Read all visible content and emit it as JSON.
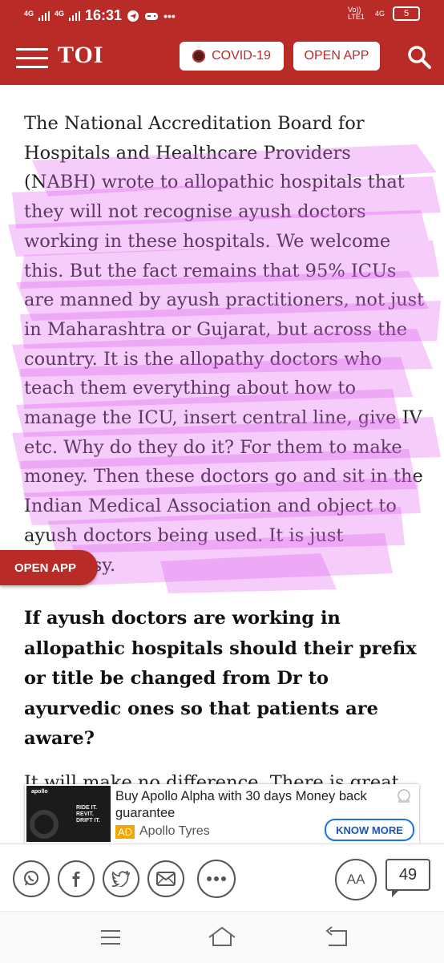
{
  "status_bar": {
    "time": "16:31",
    "network_1": "4G",
    "network_2": "4G",
    "volte": "Vo)) LTE1",
    "network_right": "4G",
    "battery": "5"
  },
  "header": {
    "logo": "TOI",
    "covid_label": "COVID-19",
    "open_app_label": "OPEN APP"
  },
  "article": {
    "paragraph": "The National Accreditation Board for Hospitals and Healthcare Providers (NABH) wrote to allopathic hospitals that they will not recognise ayush doctors working in these hospitals. We welcome this. But the fact remains that 95% ICUs are manned by ayush practitioners, not just in Maharashtra or Gujarat, but across the country. It is the allopathy doctors who teach them everything about how to manage the ICU, insert central line, give IV etc. Why do they do it? For them to make money. Then these doctors go and sit in the Indian Medical Association and object to ayush doctors being used. It is just hypocrisy.",
    "question": "If ayush doctors are working in allopathic hospitals should their prefix or title be changed from Dr to ayurvedic ones so that patients are aware?",
    "next_paragraph_partial": "It will make no difference. There is great"
  },
  "floating_button": {
    "label": "OPEN APP"
  },
  "ad": {
    "headline": "Buy Apollo Alpha with 30 days Money back guarantee",
    "badge": "AD",
    "advertiser": "Apollo Tyres",
    "cta": "KNOW MORE",
    "image_brand": "apollo",
    "image_tagline": "RIDE IT. REVIT. DRIFT IT."
  },
  "toolbar": {
    "comment_count": "49",
    "text_size_label": "AA"
  },
  "colors": {
    "brand_red": "#b92b27",
    "highlighter": "#e060f0",
    "cta_blue": "#1a73e8"
  },
  "icons": [
    "whatsapp-icon",
    "facebook-icon",
    "twitter-icon",
    "email-icon",
    "more-icon",
    "text-size-icon",
    "comments-icon",
    "search-icon",
    "menu-icon"
  ]
}
